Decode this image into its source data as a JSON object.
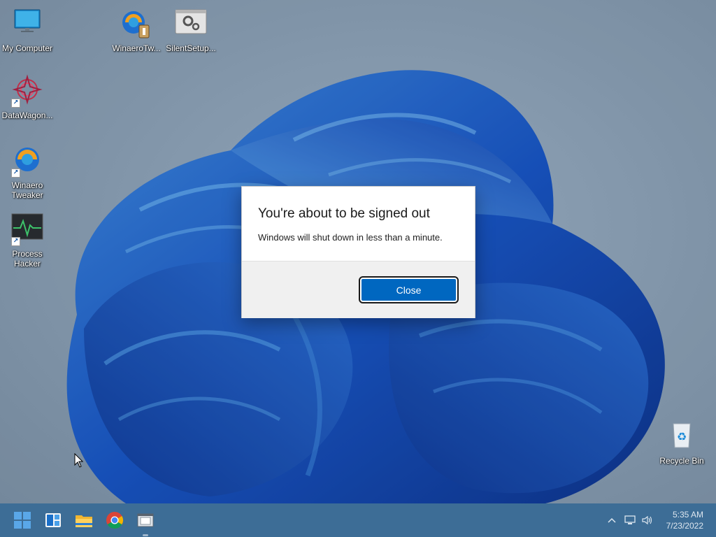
{
  "desktop_icons": [
    {
      "name": "my-computer",
      "label": "My Computer"
    },
    {
      "name": "winaero-tw",
      "label": "WinaeroTw..."
    },
    {
      "name": "silent-setup",
      "label": "SilentSetup..."
    },
    {
      "name": "datawagon",
      "label": "DataWagon..."
    },
    {
      "name": "winaero-tweaker",
      "label": "Winaero Tweaker"
    },
    {
      "name": "process-hacker",
      "label": "Process Hacker"
    },
    {
      "name": "recycle-bin",
      "label": "Recycle Bin"
    }
  ],
  "dialog": {
    "title": "You're about to be signed out",
    "message": "Windows will shut down in less than a minute.",
    "close_label": "Close"
  },
  "taskbar": {
    "pinned": [
      "start-icon",
      "widgets-icon",
      "file-explorer-icon",
      "chrome-icon",
      "app-window-icon"
    ],
    "tray": [
      "chevron-up-icon",
      "network-icon",
      "volume-icon"
    ]
  },
  "clock": {
    "time": "5:35 AM",
    "date": "7/23/2022"
  },
  "colors": {
    "accent": "#0067c0",
    "taskbar": "#3d6d96"
  }
}
